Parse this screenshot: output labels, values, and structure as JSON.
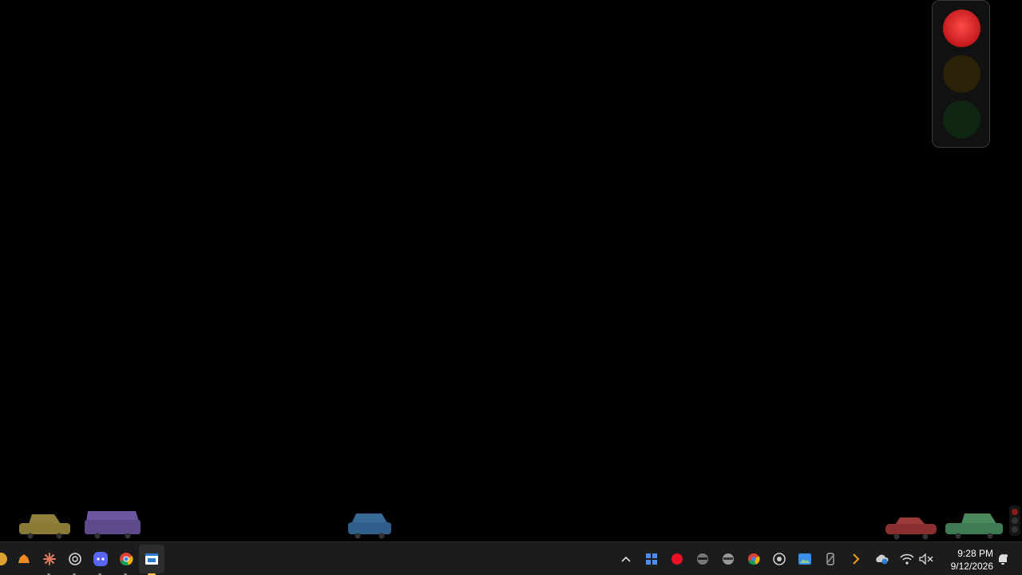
{
  "taskbar": {
    "apps": [
      {
        "name": "orange-app"
      },
      {
        "name": "app-launcher"
      },
      {
        "name": "claude"
      },
      {
        "name": "chatgpt"
      },
      {
        "name": "discord"
      },
      {
        "name": "chrome"
      },
      {
        "name": "traffic-app",
        "active": true
      }
    ],
    "tray_icons": [
      "chevron-up-icon",
      "grid-app-icon",
      "record-icon",
      "ninja-icon",
      "ninja-alt-icon",
      "chrome-icon",
      "obs-icon",
      "photos-icon",
      "usb-icon",
      "arrow-right-icon",
      "onedrive-icon",
      "wifi-icon",
      "volume-muted-icon"
    ],
    "clock": {
      "time": "9:28 PM",
      "date": "9/12/2026"
    }
  },
  "traffic_light": {
    "state": "red"
  },
  "cars": [
    {
      "name": "car-olive",
      "color": "#8a7a35"
    },
    {
      "name": "car-purple",
      "color": "#5c4a8a"
    },
    {
      "name": "car-blue",
      "color": "#2f5f8a"
    },
    {
      "name": "car-red",
      "color": "#8a2f2f"
    },
    {
      "name": "car-green",
      "color": "#3e7a52"
    }
  ],
  "colors": {
    "desktop": "#000000",
    "taskbar": "#1c1c1c",
    "accent": "#f7c948"
  }
}
